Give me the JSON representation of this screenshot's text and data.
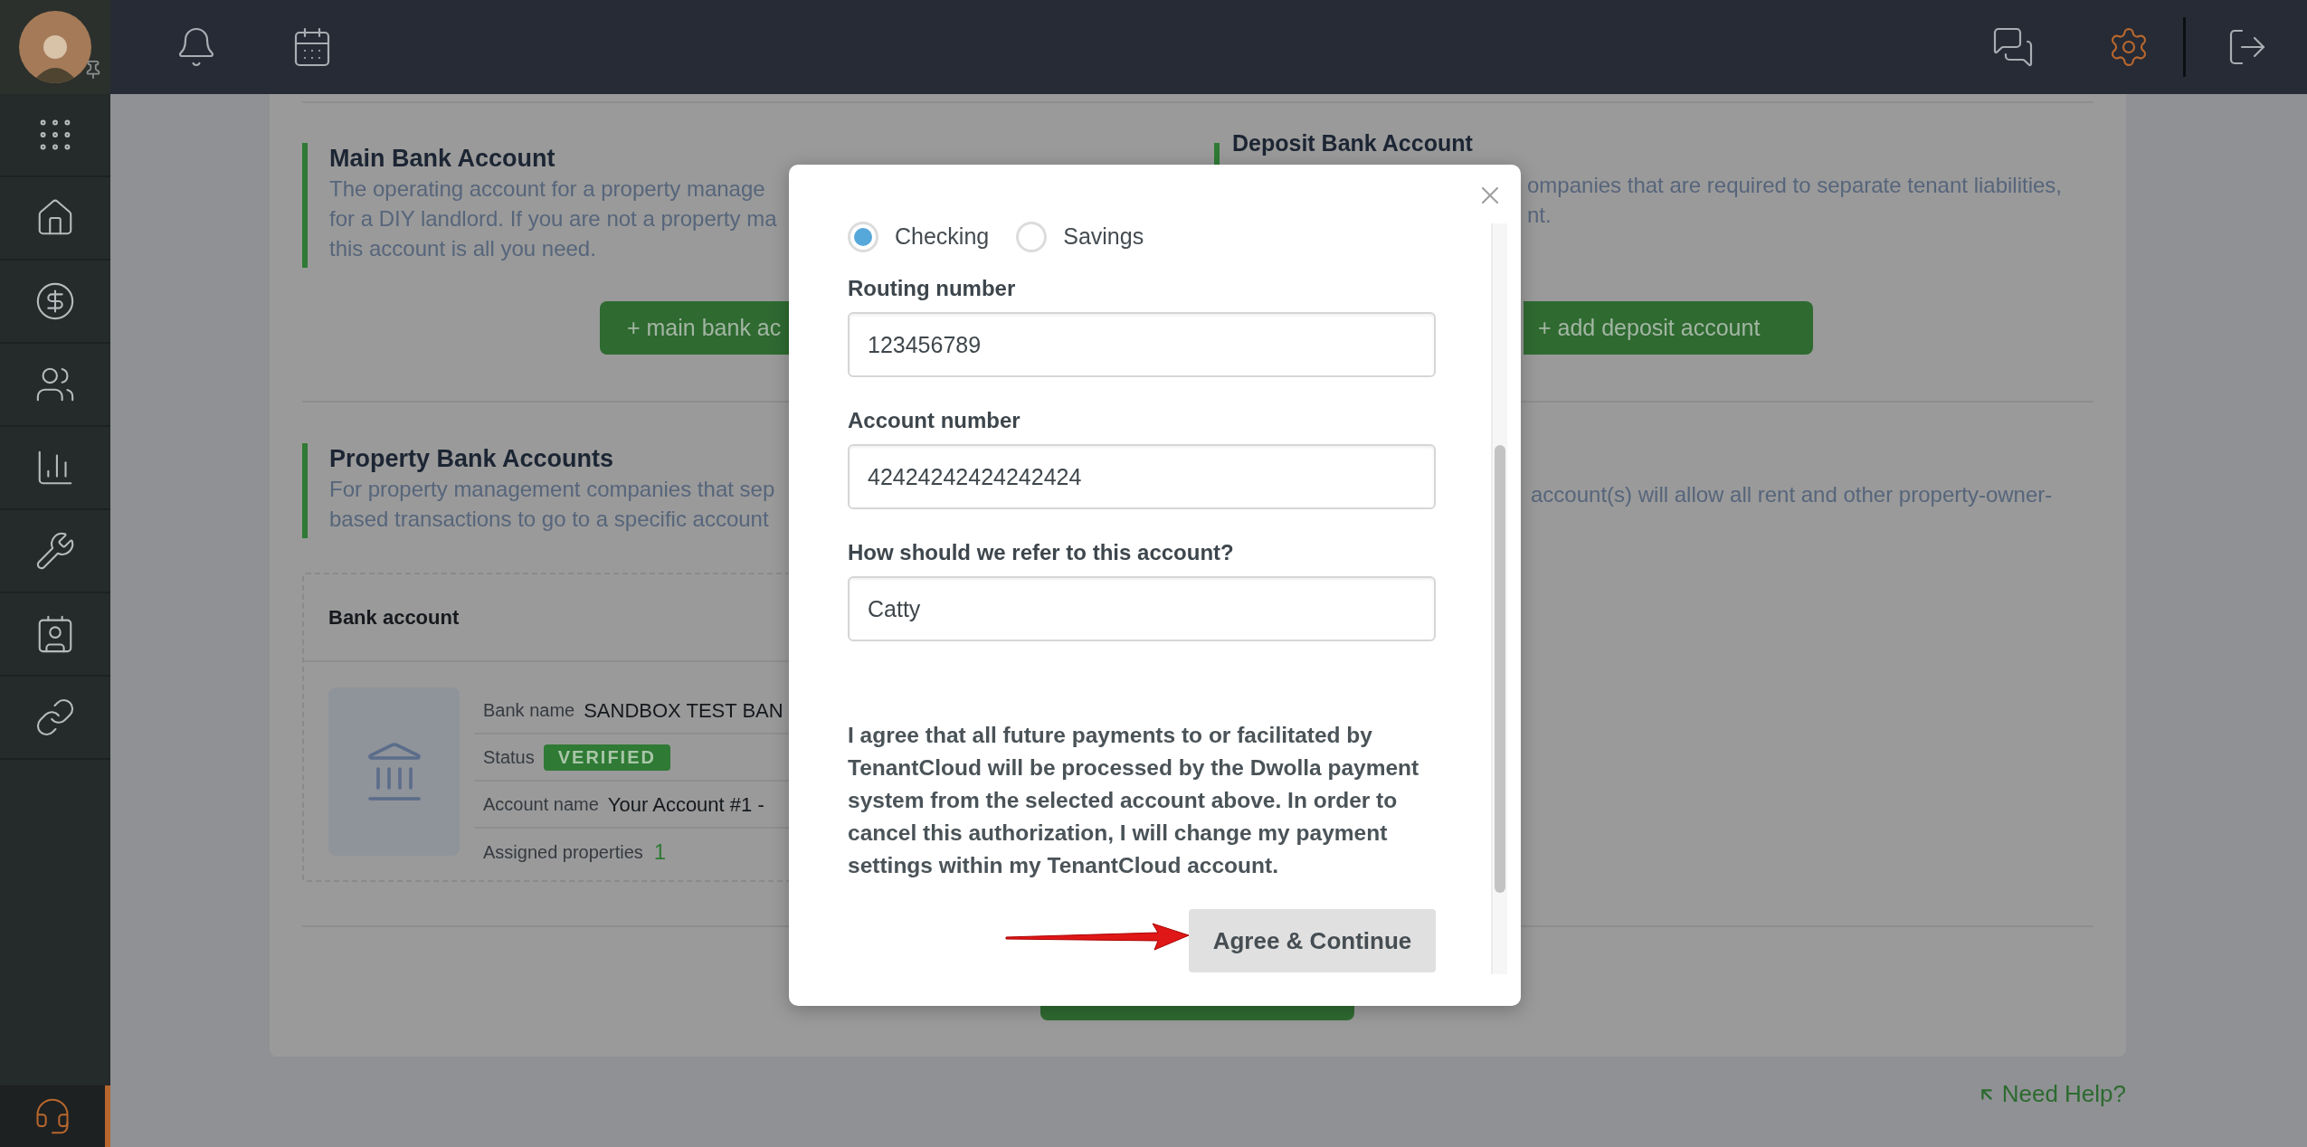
{
  "sidebar": {
    "items": [
      {
        "kind": "apps"
      },
      {
        "kind": "properties"
      },
      {
        "kind": "payments"
      },
      {
        "kind": "people"
      },
      {
        "kind": "reports"
      },
      {
        "kind": "maintenance"
      },
      {
        "kind": "documents"
      },
      {
        "kind": "integrations"
      }
    ],
    "support": {
      "selected": true
    }
  },
  "top_bar": {
    "left": [
      {
        "kind": "notifications"
      },
      {
        "kind": "calendar"
      }
    ],
    "right": [
      {
        "kind": "messages",
        "selected": false
      },
      {
        "kind": "settings",
        "selected": true
      },
      {
        "kind": "logout",
        "selected": false
      }
    ]
  },
  "main_bank_account": {
    "title": "Main Bank Account",
    "description_lines": [
      "The operating account for a property manage",
      "for a DIY landlord. If you are not a property ma",
      "this account is all you need."
    ],
    "button": "+ main bank ac"
  },
  "deposit_bank_account": {
    "title": "Deposit Bank Account",
    "description_lines": [
      "ompanies that are required to separate tenant liabilities,",
      "nt."
    ],
    "button": "+ add deposit account"
  },
  "property_bank_accounts": {
    "title": "Property Bank Accounts",
    "description_lines": [
      "For property management companies that sep",
      "based transactions to go to a specific account"
    ],
    "description_right": "account(s) will allow all rent and other property-owner-",
    "bank_account_card": {
      "heading": "Bank account",
      "fields": [
        {
          "label": "Bank name",
          "value": "SANDBOX TEST BAN",
          "kind": "text"
        },
        {
          "label": "Status",
          "value": "VERIFIED",
          "kind": "badge"
        },
        {
          "label": "Account name",
          "value": "Your Account #1 -",
          "kind": "text"
        },
        {
          "label": "Assigned properties",
          "value": "1",
          "kind": "count"
        }
      ]
    }
  },
  "modal": {
    "account_types": [
      {
        "label": "Checking",
        "selected": true
      },
      {
        "label": "Savings",
        "selected": false
      }
    ],
    "fields": [
      {
        "label": "Routing number",
        "value": "123456789"
      },
      {
        "label": "Account number",
        "value": "42424242424242424"
      },
      {
        "label": "How should we refer to this account?",
        "value": "Catty"
      }
    ],
    "agreement": "I agree that all future payments to or facilitated by TenantCloud will be processed by the Dwolla payment system from the selected account above. In order to cancel this authorization, I will change my payment settings within my TenantCloud account.",
    "button": "Agree & Continue"
  },
  "help_link": "Need Help?"
}
